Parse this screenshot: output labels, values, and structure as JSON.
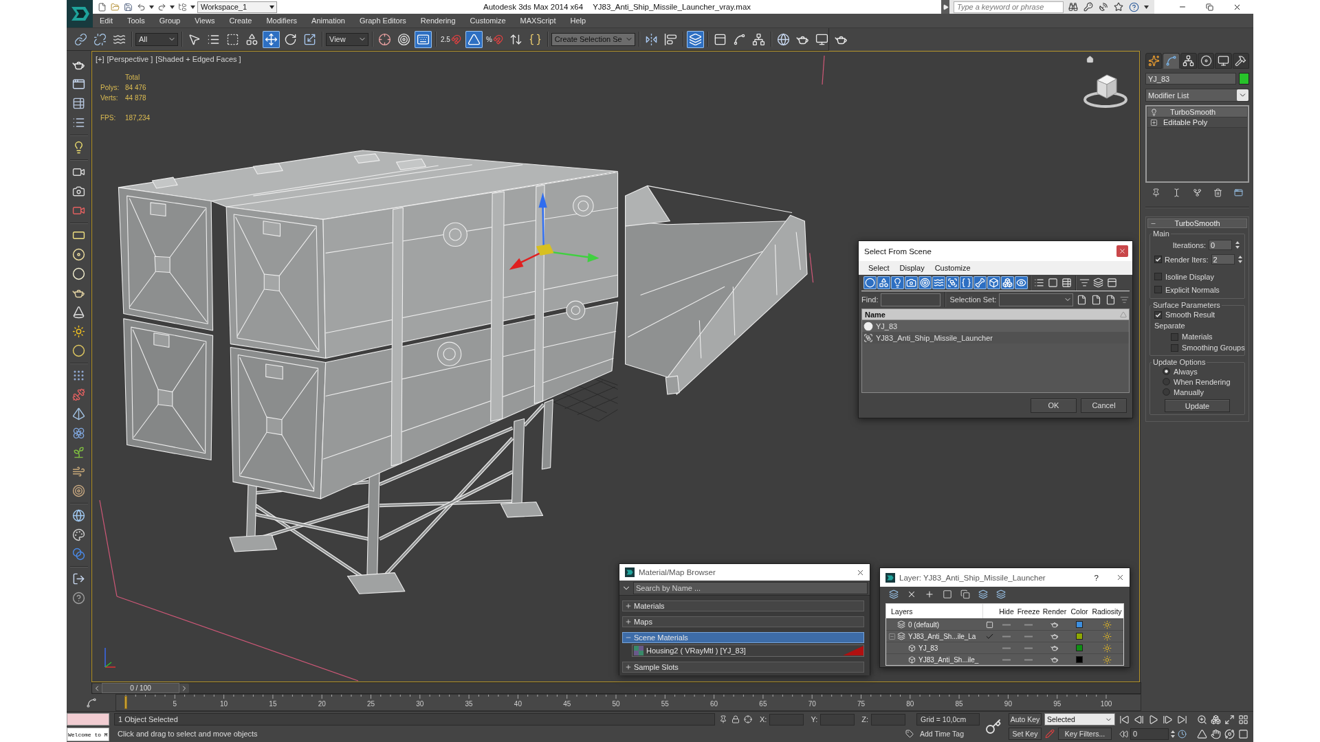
{
  "title_bar": {
    "workspace": "Workspace_1",
    "app_name": "Autodesk 3ds Max 2014 x64",
    "file_name": "YJ83_Anti_Ship_Missile_Launcher_vray.max",
    "search": {
      "placeholder": "Type a keyword or phrase"
    }
  },
  "menu": [
    "Edit",
    "Tools",
    "Group",
    "Views",
    "Create",
    "Modifiers",
    "Animation",
    "Graph Editors",
    "Rendering",
    "Customize",
    "MAXScript",
    "Help"
  ],
  "main_toolbar": [
    {
      "kind": "tool",
      "active": false
    },
    {
      "kind": "tool",
      "active": false
    },
    {
      "kind": "tool",
      "active": false
    },
    {
      "kind": "dropdown",
      "value": "All"
    },
    {
      "kind": "tool",
      "active": false
    },
    {
      "kind": "tool",
      "active": false
    },
    {
      "kind": "tool",
      "active": false
    },
    {
      "kind": "tool",
      "active": false
    },
    {
      "kind": "tool",
      "active": true
    },
    {
      "kind": "tool",
      "active": false
    },
    {
      "kind": "tool",
      "active": false
    },
    {
      "kind": "dropdown",
      "value": "View"
    },
    {
      "kind": "tool",
      "active": false
    },
    {
      "kind": "tool",
      "active": false
    },
    {
      "kind": "tool",
      "active": true
    },
    {
      "kind": "snap",
      "label": "2.5",
      "active": false
    },
    {
      "kind": "tool",
      "active": true
    },
    {
      "kind": "snap",
      "label": "%",
      "active": false
    },
    {
      "kind": "tool",
      "active": false
    },
    {
      "kind": "tool",
      "active": false
    },
    {
      "kind": "dropdown",
      "value": "Create Selection Se"
    },
    {
      "kind": "tool",
      "active": false
    },
    {
      "kind": "tool",
      "active": false
    },
    {
      "kind": "tool",
      "active": true
    },
    {
      "kind": "tool",
      "active": false
    },
    {
      "kind": "tool",
      "active": false
    },
    {
      "kind": "tool",
      "active": false
    },
    {
      "kind": "tool",
      "active": false
    },
    {
      "kind": "tool",
      "active": false
    },
    {
      "kind": "tool",
      "active": false
    },
    {
      "kind": "tool",
      "active": false
    }
  ],
  "viewport": {
    "labels": [
      "[+]",
      "[Perspective ]",
      "[Shaded + Edged Faces ]"
    ],
    "stats": {
      "header": "Total",
      "rows": [
        {
          "label": "Polys:",
          "value": "84 476"
        },
        {
          "label": "Verts:",
          "value": "44 878"
        }
      ],
      "fps": {
        "label": "FPS:",
        "value": "187,234"
      }
    }
  },
  "select_from_scene": {
    "title": "Select From Scene",
    "menu": [
      "Select",
      "Display",
      "Customize"
    ],
    "filters": [
      {
        "on": true
      },
      {
        "on": true
      },
      {
        "on": true
      },
      {
        "on": true
      },
      {
        "on": true
      },
      {
        "on": true
      },
      {
        "on": true
      },
      {
        "on": true
      },
      {
        "on": true
      },
      {
        "on": true
      },
      {
        "on": true
      },
      {
        "on": true
      }
    ],
    "find_label": "Find:",
    "selection_set_label": "Selection Set:",
    "column": "Name",
    "rows": [
      {
        "name": "YJ_83",
        "kind": "geometry",
        "selected": false
      },
      {
        "name": "YJ83_Anti_Ship_Missile_Launcher",
        "kind": "group",
        "selected": false
      }
    ],
    "buttons": [
      "OK",
      "Cancel"
    ]
  },
  "material_browser": {
    "title": "Material/Map Browser",
    "search": {
      "placeholder": "Search by Name ..."
    },
    "groups": [
      {
        "label": "Materials",
        "expanded": false,
        "selected": false
      },
      {
        "label": "Maps",
        "expanded": false,
        "selected": false
      },
      {
        "label": "Scene Materials",
        "expanded": true,
        "selected": true,
        "items": [
          "Housing2 ( VRayMtl ) [YJ_83]"
        ]
      },
      {
        "label": "Sample Slots",
        "expanded": false,
        "selected": false
      }
    ]
  },
  "layer_manager": {
    "title": "Layer: YJ83_Anti_Ship_Missile_Launcher",
    "help": "?",
    "columns": [
      "Layers",
      "Hide",
      "Freeze",
      "Render",
      "Color",
      "Radiosity"
    ],
    "layers": [
      {
        "name": "0 (default)",
        "current": false,
        "hidden": false,
        "frozen": false,
        "renderable": true,
        "color": "#3d8fe0"
      },
      {
        "name": "YJ83_Anti_Sh...ile_La",
        "current": true,
        "expanded": true,
        "hidden": false,
        "frozen": false,
        "renderable": true,
        "color": "#8ea800",
        "children": [
          {
            "name": "YJ_83",
            "hidden": false,
            "frozen": false,
            "renderable": true,
            "color": "#0f8f14"
          },
          {
            "name": "YJ83_Anti_Sh...ile_",
            "hidden": false,
            "frozen": false,
            "renderable": true,
            "color": "#000000"
          }
        ]
      }
    ]
  },
  "command_panel": {
    "tabs": [
      {
        "selected": false
      },
      {
        "selected": true
      },
      {
        "selected": false
      },
      {
        "selected": false
      },
      {
        "selected": false
      },
      {
        "selected": false
      }
    ],
    "object_name": "YJ_83",
    "modifier_list": "Modifier List",
    "stack": [
      {
        "name": "TurboSmooth",
        "kind": "modifier",
        "selected": true
      },
      {
        "name": "Editable Poly",
        "kind": "base",
        "selected": false
      }
    ],
    "rollout": {
      "title": "TurboSmooth",
      "expanded": true,
      "main": {
        "title": "Main",
        "iterations": {
          "label": "Iterations:",
          "value": "0"
        },
        "render_iters": {
          "label": "Render Iters:",
          "value": "2",
          "checked": true
        },
        "options": [
          {
            "label": "Isoline Display",
            "checked": false
          },
          {
            "label": "Explicit Normals",
            "checked": false
          }
        ]
      },
      "surface": {
        "title": "Surface Parameters",
        "smooth_result": {
          "label": "Smooth Result",
          "checked": true
        },
        "separate": "Separate",
        "options": [
          {
            "label": "Materials",
            "checked": false
          },
          {
            "label": "Smoothing Groups",
            "checked": false
          }
        ]
      },
      "update": {
        "title": "Update Options",
        "options": [
          {
            "label": "Always",
            "selected": true
          },
          {
            "label": "When Rendering",
            "selected": false
          },
          {
            "label": "Manually",
            "selected": false
          }
        ],
        "button": "Update"
      }
    }
  },
  "time_slider": {
    "label": "0 / 100",
    "level": 0
  },
  "track_bar": {
    "ticks": [
      "5",
      "10",
      "15",
      "20",
      "25",
      "30",
      "35",
      "40",
      "45",
      "50",
      "55",
      "60",
      "65",
      "70",
      "75",
      "80",
      "85",
      "90",
      "95",
      "100"
    ]
  },
  "status_bar": {
    "listener_output": "Welcome to M",
    "selection": "1 Object Selected",
    "prompt": "Click and drag to select and move objects",
    "coords": [
      "X:",
      "Y:",
      "Z:"
    ],
    "grid": "Grid = 10,0cm",
    "time_tag": "Add Time Tag",
    "auto_key": {
      "label": "Auto Key",
      "on": false
    },
    "key_mode": "Selected",
    "set_key": "Set Key",
    "key_filters": "Key Filters...",
    "frame": "0"
  }
}
